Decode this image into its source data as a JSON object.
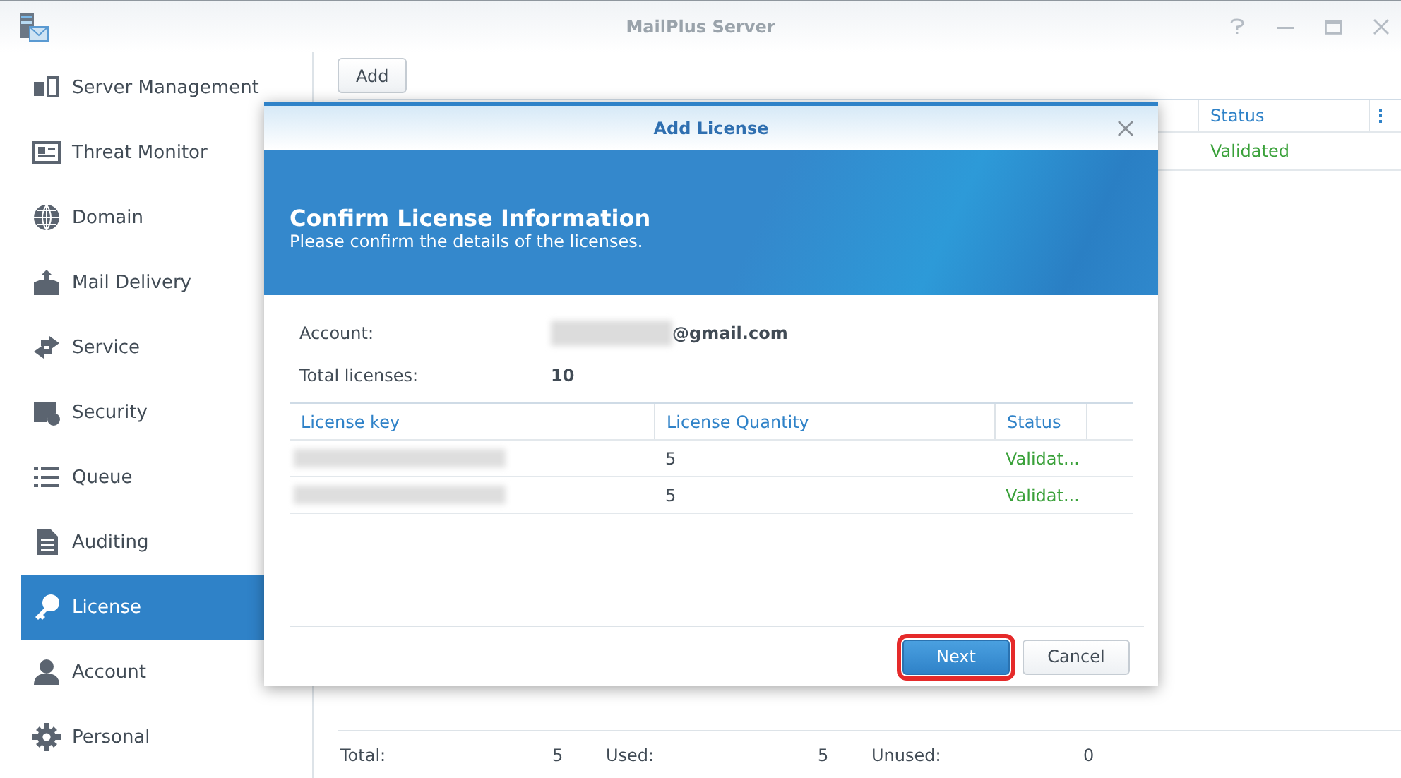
{
  "window": {
    "title": "MailPlus Server"
  },
  "sidebar": {
    "items": [
      {
        "label": "Server Management",
        "selected": false
      },
      {
        "label": "Threat Monitor",
        "selected": false
      },
      {
        "label": "Domain",
        "selected": false
      },
      {
        "label": "Mail Delivery",
        "selected": false
      },
      {
        "label": "Service",
        "selected": false
      },
      {
        "label": "Security",
        "selected": false
      },
      {
        "label": "Queue",
        "selected": false
      },
      {
        "label": "Auditing",
        "selected": false
      },
      {
        "label": "License",
        "selected": true
      },
      {
        "label": "Account",
        "selected": false
      },
      {
        "label": "Personal",
        "selected": false
      }
    ]
  },
  "toolbar": {
    "add_button": "Add"
  },
  "license_table": {
    "columns": [
      "Status"
    ],
    "rows": [
      {
        "status": "Validated"
      }
    ]
  },
  "footer": [
    {
      "label": "Total:",
      "value": "5"
    },
    {
      "label": "Used:",
      "value": "5"
    },
    {
      "label": "Unused:",
      "value": "0"
    }
  ],
  "dialog": {
    "title": "Add License",
    "heading": "Confirm License Information",
    "subheading": "Please confirm the details of the licenses.",
    "account_label": "Account:",
    "account_value": "@gmail.com",
    "total_label": "Total licenses:",
    "total_value": "10",
    "columns": [
      "License key",
      "License Quantity",
      "Status"
    ],
    "rows": [
      {
        "quantity": "5",
        "status": "Validat..."
      },
      {
        "quantity": "5",
        "status": "Validat..."
      }
    ],
    "buttons": [
      {
        "label": "Next",
        "kind": "primary",
        "highlighted": true
      },
      {
        "label": "Cancel",
        "kind": "secondary",
        "highlighted": false
      }
    ]
  }
}
